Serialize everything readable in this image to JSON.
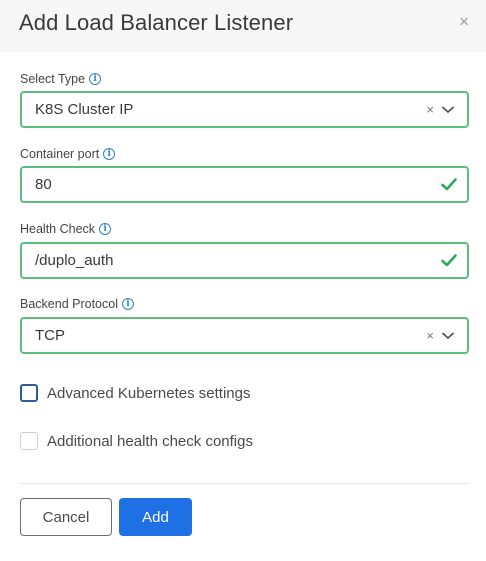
{
  "dialog": {
    "title": "Add Load Balancer Listener",
    "close_glyph": "×"
  },
  "fields": {
    "select_type": {
      "label": "Select Type",
      "value": "K8S Cluster IP"
    },
    "container_port": {
      "label": "Container port",
      "value": "80"
    },
    "health_check": {
      "label": "Health Check",
      "value": "/duplo_auth"
    },
    "backend_protocol": {
      "label": "Backend Protocol",
      "value": "TCP"
    }
  },
  "info_glyph": "i",
  "clear_glyph": "×",
  "checkboxes": {
    "advanced_k8s": {
      "label": "Advanced Kubernetes settings",
      "checked": false
    },
    "additional_health": {
      "label": "Additional health check configs",
      "checked": false
    }
  },
  "buttons": {
    "cancel": "Cancel",
    "add": "Add"
  },
  "colors": {
    "valid_border": "#5cbe7d",
    "primary": "#1f6fe5",
    "info": "#2e86c7"
  },
  "icons": [
    "close-icon",
    "info-icon",
    "clear-icon",
    "chevron-down-icon",
    "check-icon"
  ]
}
